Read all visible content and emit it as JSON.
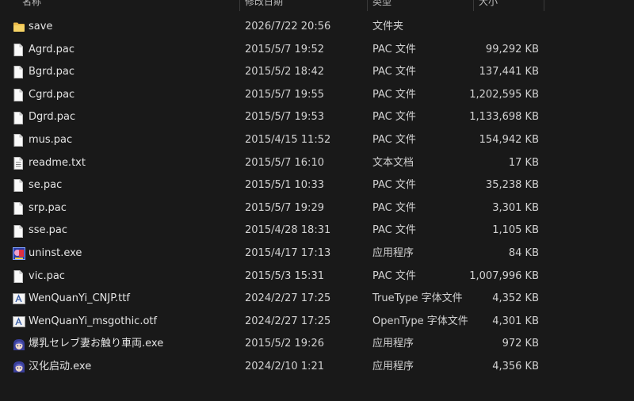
{
  "columns": {
    "name": "名称",
    "date": "修改日期",
    "type": "类型",
    "size": "大小"
  },
  "files": [
    {
      "name": "save",
      "date": "2026/7/22 20:56",
      "type": "文件夹",
      "size": "",
      "icon": "folder-icon"
    },
    {
      "name": "Agrd.pac",
      "date": "2015/5/7 19:52",
      "type": "PAC 文件",
      "size": "99,292 KB",
      "icon": "file-icon"
    },
    {
      "name": "Bgrd.pac",
      "date": "2015/5/2 18:42",
      "type": "PAC 文件",
      "size": "137,441 KB",
      "icon": "file-icon"
    },
    {
      "name": "Cgrd.pac",
      "date": "2015/5/7 19:55",
      "type": "PAC 文件",
      "size": "1,202,595 KB",
      "icon": "file-icon"
    },
    {
      "name": "Dgrd.pac",
      "date": "2015/5/7 19:53",
      "type": "PAC 文件",
      "size": "1,133,698 KB",
      "icon": "file-icon"
    },
    {
      "name": "mus.pac",
      "date": "2015/4/15 11:52",
      "type": "PAC 文件",
      "size": "154,942 KB",
      "icon": "file-icon"
    },
    {
      "name": "readme.txt",
      "date": "2015/5/7 16:10",
      "type": "文本文档",
      "size": "17 KB",
      "icon": "text-file-icon"
    },
    {
      "name": "se.pac",
      "date": "2015/5/1 10:33",
      "type": "PAC 文件",
      "size": "35,238 KB",
      "icon": "file-icon"
    },
    {
      "name": "srp.pac",
      "date": "2015/5/7 19:29",
      "type": "PAC 文件",
      "size": "3,301 KB",
      "icon": "file-icon"
    },
    {
      "name": "sse.pac",
      "date": "2015/4/28 18:31",
      "type": "PAC 文件",
      "size": "1,105 KB",
      "icon": "file-icon"
    },
    {
      "name": "uninst.exe",
      "date": "2015/4/17 17:13",
      "type": "应用程序",
      "size": "84 KB",
      "icon": "uninstaller-app-icon"
    },
    {
      "name": "vic.pac",
      "date": "2015/5/3 15:31",
      "type": "PAC 文件",
      "size": "1,007,996 KB",
      "icon": "file-icon"
    },
    {
      "name": "WenQuanYi_CNJP.ttf",
      "date": "2024/2/27 17:25",
      "type": "TrueType 字体文件",
      "size": "4,352 KB",
      "icon": "font-file-icon"
    },
    {
      "name": "WenQuanYi_msgothic.otf",
      "date": "2024/2/27 17:25",
      "type": "OpenType 字体文件",
      "size": "4,301 KB",
      "icon": "font-file-icon"
    },
    {
      "name": "爆乳セレブ妻お触り車両.exe",
      "date": "2015/5/2 19:26",
      "type": "应用程序",
      "size": "972 KB",
      "icon": "character-app-icon"
    },
    {
      "name": "汉化启动.exe",
      "date": "2024/2/10 1:21",
      "type": "应用程序",
      "size": "4,356 KB",
      "icon": "character-app-icon"
    }
  ],
  "colors": {
    "background": "#191919",
    "text": "#e4e4e4",
    "folder": "#f2c94c"
  }
}
